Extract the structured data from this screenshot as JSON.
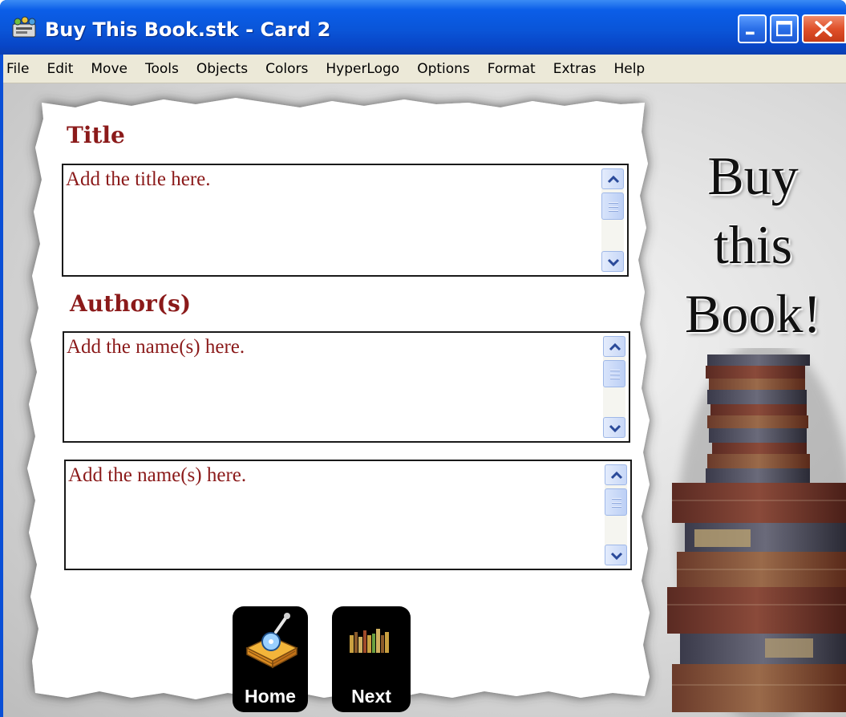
{
  "window": {
    "title": "Buy This Book.stk - Card 2"
  },
  "menubar": {
    "items": [
      "File",
      "Edit",
      "Move",
      "Tools",
      "Objects",
      "Colors",
      "HyperLogo",
      "Options",
      "Format",
      "Extras",
      "Help"
    ]
  },
  "card": {
    "title_label": "Title",
    "title_field": "Add the title here.",
    "author_label": "Author(s)",
    "author_field_1": "Add the name(s) here.",
    "author_field_2": "Add the name(s) here.",
    "headline": [
      "Buy",
      "this",
      "Book!"
    ],
    "home_button": "Home",
    "next_button": "Next"
  },
  "colors": {
    "label_text": "#8b1a1a",
    "titlebar": "#0a55d8",
    "menubar": "#ece9d8"
  }
}
